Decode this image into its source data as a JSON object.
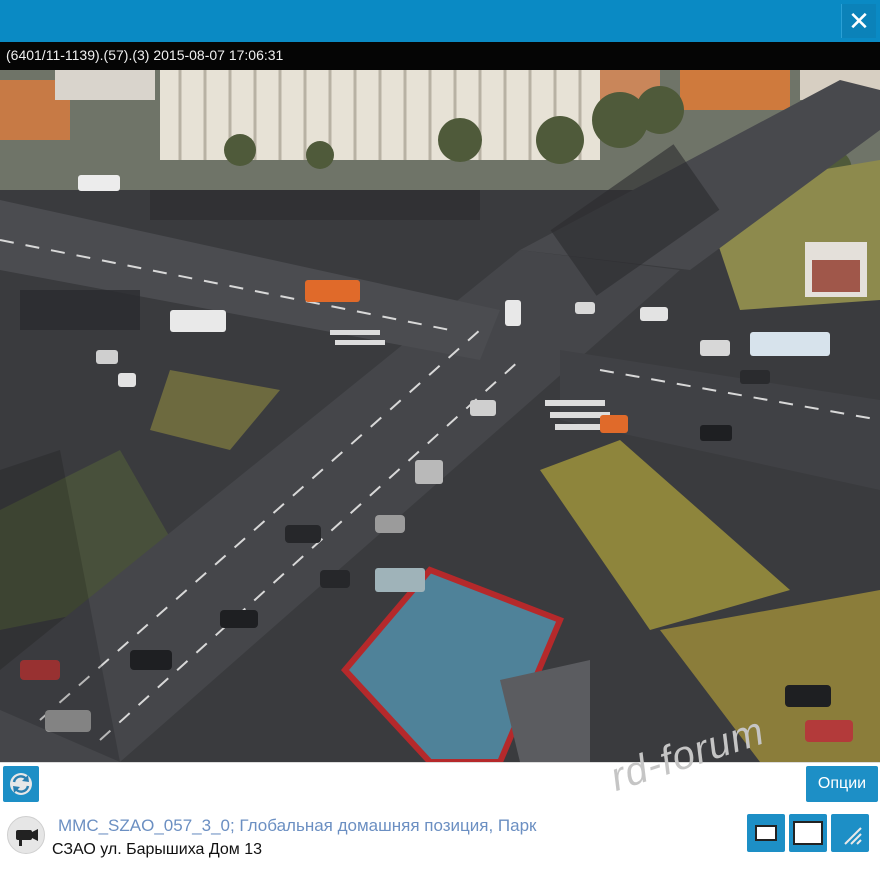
{
  "window": {
    "close_glyph": "✕",
    "close_icon": "close-icon"
  },
  "video": {
    "timestamp_overlay": "(6401/11-1139).(57).(3) 2015-08-07 17:06:31"
  },
  "toolbar": {
    "refresh_icon": "refresh-icon",
    "options_label": "Опции",
    "watermark": "rd-forum"
  },
  "camera": {
    "icon": "camera-icon",
    "name": "MMC_SZAO_057_3_0; Глобальная домашняя позиция, Парк",
    "address": "СЗАО ул. Барышиха Дом 13"
  },
  "view_controls": [
    {
      "icon": "window-small-icon"
    },
    {
      "icon": "window-large-icon"
    },
    {
      "icon": "resize-corner-icon"
    }
  ],
  "colors": {
    "accent": "#1d8fc6",
    "titlebar": "#0a8ac4",
    "camera_name": "#6b8fc2"
  }
}
